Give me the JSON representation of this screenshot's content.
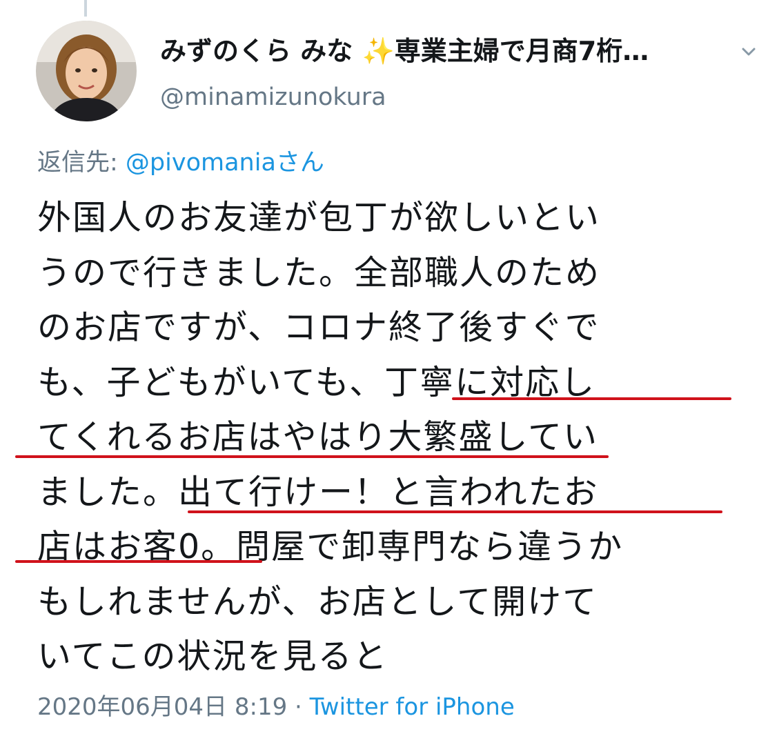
{
  "author": {
    "display_name": "みずのくら みな",
    "sparkle": "✨",
    "display_name_suffix": "専業主婦で月商7桁…",
    "handle": "@minamizunokura"
  },
  "reply": {
    "prefix": "返信先: ",
    "mention": "@pivomaniaさん"
  },
  "tweet": {
    "lines": [
      "外国人のお友達が包丁が欲しいとい",
      "うので行きました。全部職人のため",
      "のお店ですが、コロナ終了後すぐで",
      "も、子どもがいても、丁寧に対応し",
      "てくれるお店はやはり大繁盛してい",
      "ました。出て行けー！と言われたお",
      "店はお客0。問屋で卸専門なら違うか",
      "もしれませんが、お店として開けて",
      "いてこの状況を見ると"
    ]
  },
  "meta": {
    "timestamp": "2020年06月04日 8:19",
    "separator": " · ",
    "source": "Twitter for iPhone"
  },
  "icons": {
    "avatar": "profile-photo",
    "more": "chevron-down-icon",
    "emoji": "sparkles-emoji"
  },
  "colors": {
    "text": "#14171a",
    "secondary": "#657786",
    "link": "#1b95e0",
    "underline": "#d0121b"
  }
}
